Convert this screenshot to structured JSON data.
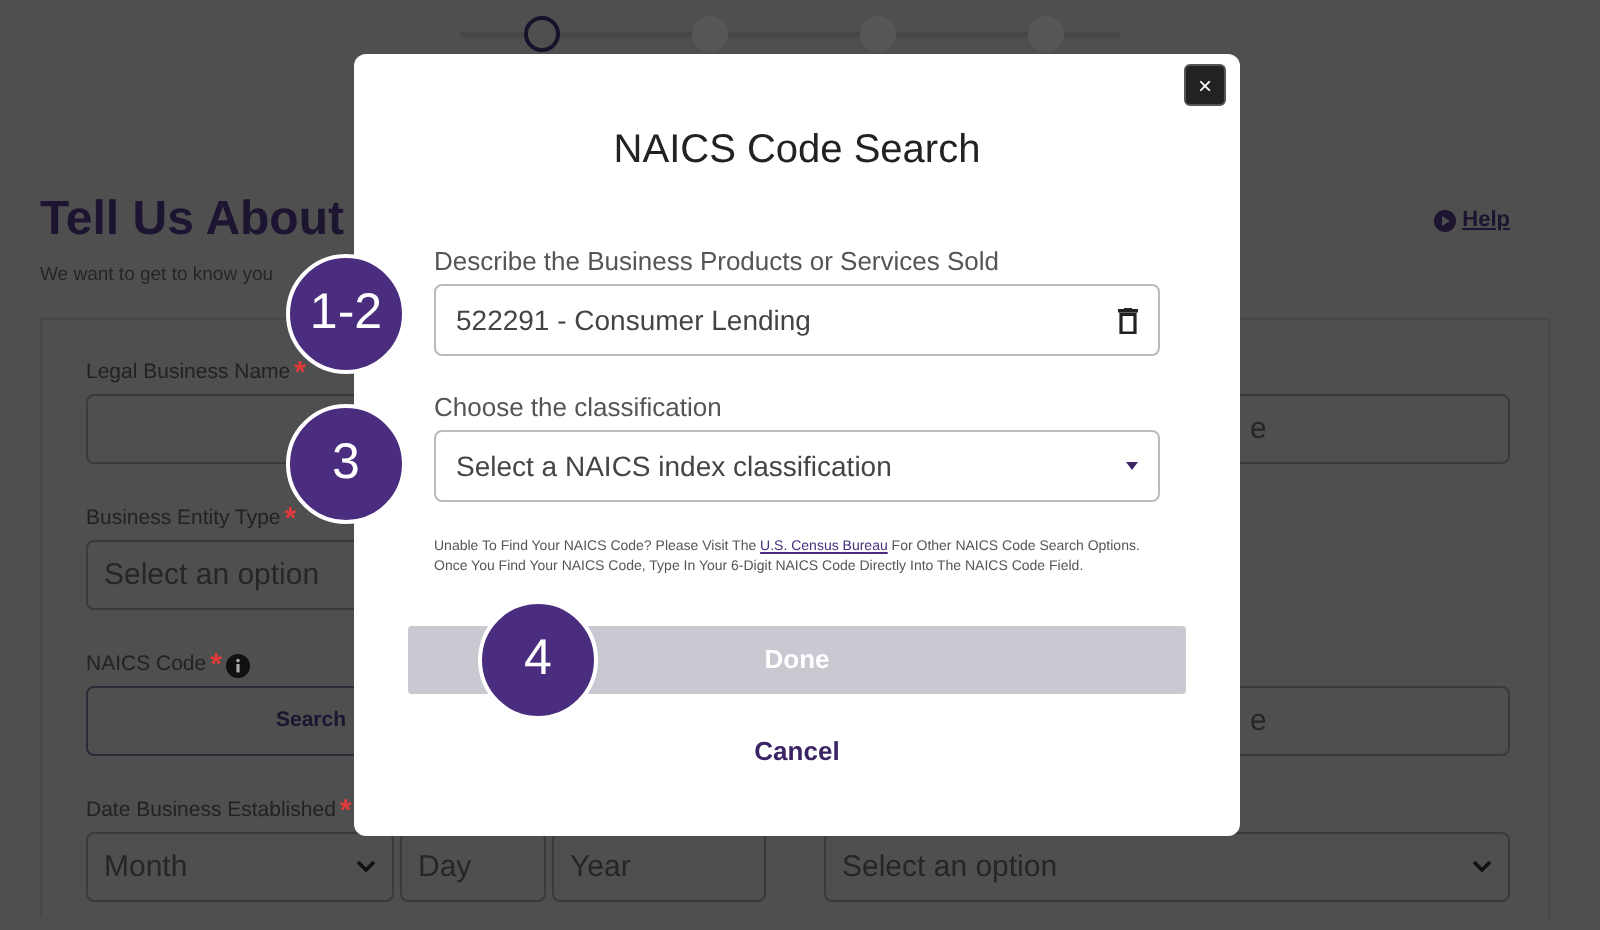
{
  "stepper": {
    "steps": [
      {
        "selected": true
      },
      {
        "selected": false
      },
      {
        "selected": false
      },
      {
        "selected": false
      }
    ]
  },
  "page": {
    "title": "Tell Us About",
    "subtitle": "We want to get to know you",
    "help": "Help",
    "left_fields": [
      {
        "kind": "input",
        "label": "Legal Business Name",
        "required_mark": "*"
      },
      {
        "kind": "select",
        "label": "Business Entity Type",
        "required_mark": "*",
        "placeholder": "Select an option"
      },
      {
        "kind": "button",
        "label": "NAICS Code",
        "required_mark": "*",
        "info": true,
        "value": "Search"
      },
      {
        "kind": "date",
        "label": "Date Business Established",
        "required_mark": "*",
        "parts": [
          {
            "kind": "select",
            "placeholder": "Month"
          },
          {
            "kind": "input",
            "placeholder": "Day"
          },
          {
            "kind": "input",
            "placeholder": "Year"
          }
        ]
      }
    ],
    "right_fields": [
      {
        "kind": "input",
        "placeholder": "e"
      },
      {
        "kind": "input",
        "placeholder": "e"
      },
      {
        "kind": "select",
        "placeholder": "Select an option"
      }
    ]
  },
  "modal": {
    "title": "NAICS Code Search",
    "close": "×",
    "fields": [
      {
        "kind": "input",
        "label": "Describe the Business Products or Services Sold",
        "value": "522291 - Consumer Lending",
        "clearable": true
      },
      {
        "kind": "select",
        "label": "Choose the classification",
        "placeholder": "Select a NAICS index classification"
      }
    ],
    "note": {
      "before": "Unable To Find Your NAICS Code? Please Visit The",
      "link": "U.S. Census Bureau",
      "after": "For Other NAICS Code Search Options.",
      "line2": "Once You Find Your NAICS Code, Type In Your 6-Digit NAICS Code Directly Into The NAICS Code Field."
    },
    "done": {
      "label": "Done",
      "disabled": true
    },
    "cancel": "Cancel"
  },
  "callouts": [
    {
      "label": "1-2"
    },
    {
      "label": "3"
    },
    {
      "label": "4"
    }
  ]
}
